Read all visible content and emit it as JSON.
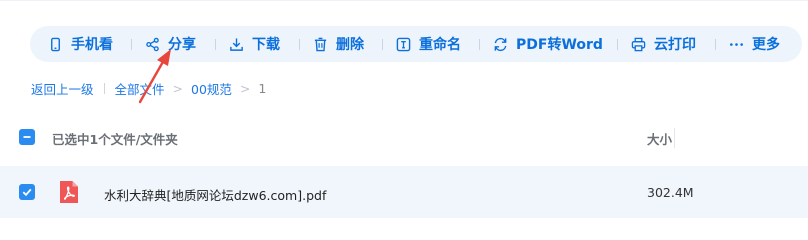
{
  "toolbar": {
    "phone_view": "手机看",
    "share": "分享",
    "download": "下载",
    "delete": "删除",
    "rename": "重命名",
    "pdf_to_word": "PDF转Word",
    "cloud_print": "云打印",
    "more": "更多"
  },
  "breadcrumb": {
    "back": "返回上一级",
    "all_files": "全部文件",
    "folder": "00规范",
    "current": "1",
    "separator": ">"
  },
  "list_header": {
    "selection_label": "已选中1个文件/文件夹",
    "size_column": "大小"
  },
  "files": [
    {
      "name": "水利大辞典[地质网论坛dzw6.com].pdf",
      "size": "302.4M",
      "selected": true
    }
  ],
  "colors": {
    "accent": "#0b6fdc",
    "toolbar_bg": "#eef4fc",
    "checkbox": "#2a8cf0",
    "selected_row_bg": "#f1f6fd",
    "pdf_icon": "#ef5656",
    "annotation_arrow": "#e8453c"
  },
  "icons": {
    "phone_view": "phone-icon",
    "share": "share-icon",
    "download": "download-icon",
    "delete": "trash-icon",
    "rename": "rename-icon",
    "pdf_to_word": "convert-icon",
    "cloud_print": "printer-icon",
    "more": "ellipsis-icon",
    "file": "pdf-file-icon"
  }
}
